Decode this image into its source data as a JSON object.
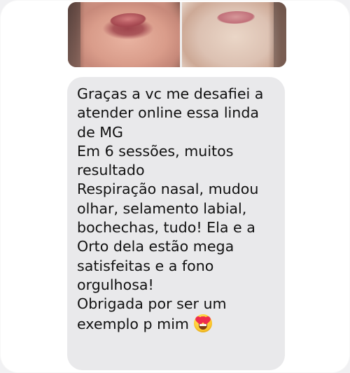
{
  "message": {
    "lines": [
      "Graças a vc me desafiei a",
      "atender online essa linda",
      "de MG",
      "Em 6 sessões, muitos",
      "resultado",
      "Respiração nasal, mudou",
      "olhar, selamento labial,",
      "bochechas, tudo! Ela e a",
      "Orto dela estão mega",
      "satisfeitas e a fono",
      "orgulhosa!",
      "Obrigada por ser um",
      "exemplo p mim"
    ],
    "emoji": "heart-eyes-emoji"
  },
  "colors": {
    "page_background": "#f1f1f3",
    "panel_background": "#ffffff",
    "bubble_background": "#e9e9eb",
    "text": "#111111"
  },
  "icons": {
    "message_emoji": "heart-eyes-emoji"
  }
}
